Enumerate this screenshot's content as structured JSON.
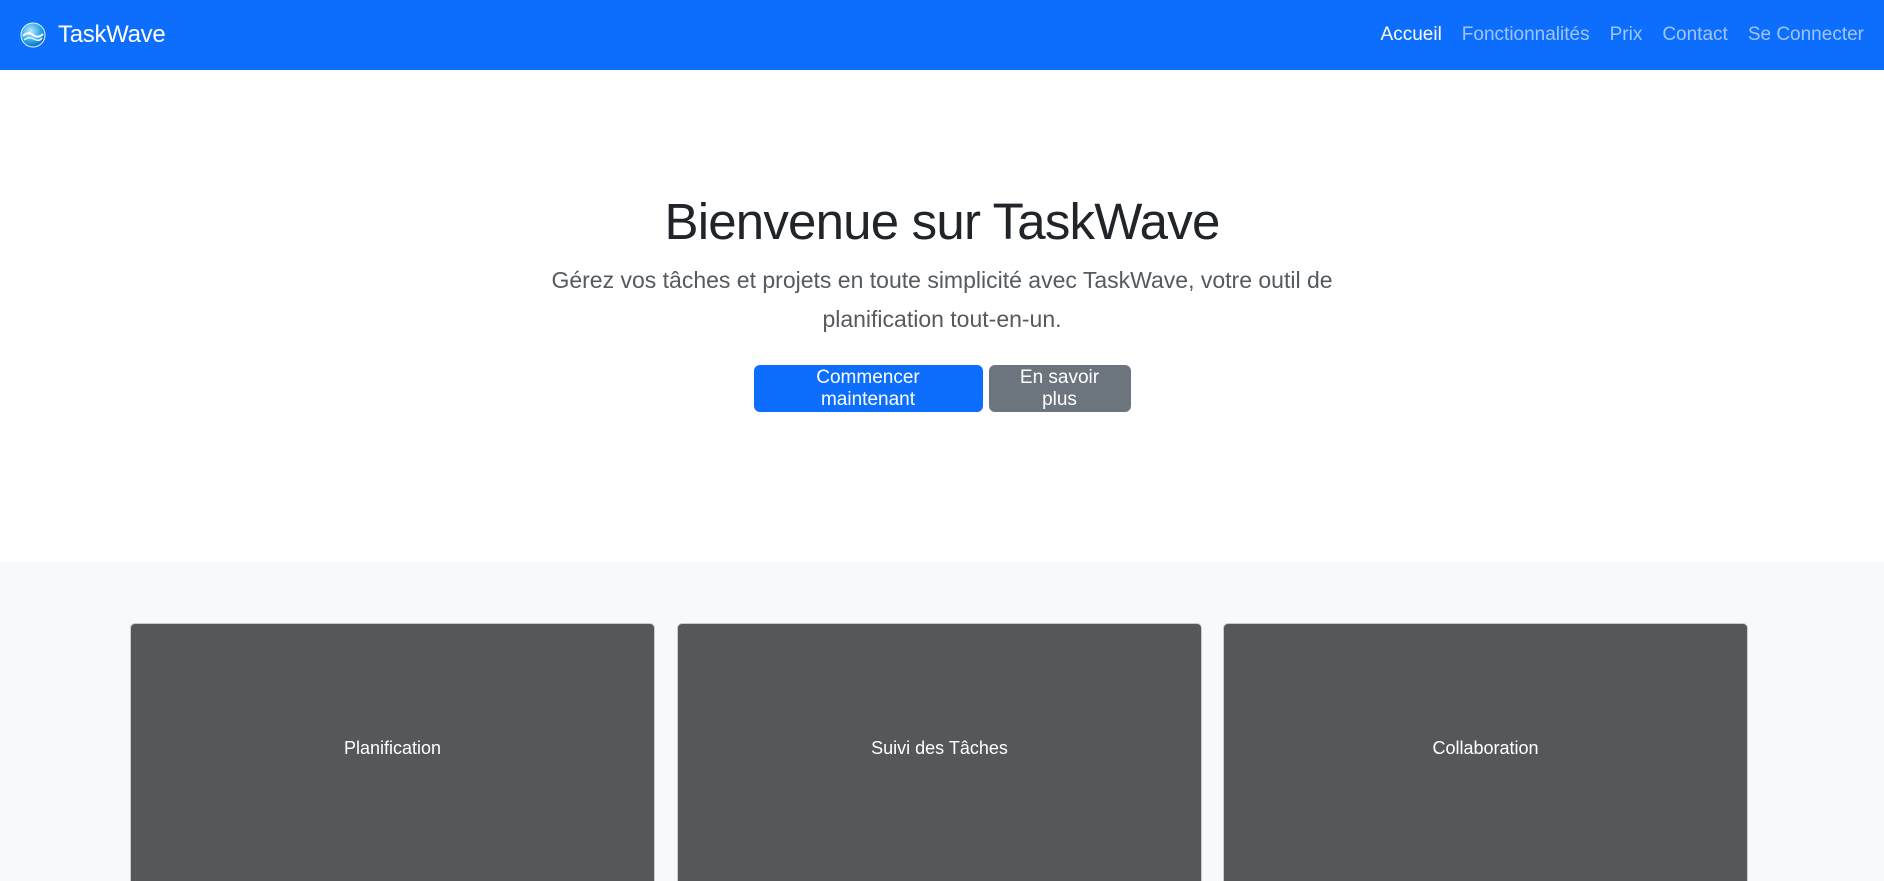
{
  "navbar": {
    "brand": "TaskWave",
    "logo_icon": "wave-globe-icon",
    "links": [
      {
        "label": "Accueil",
        "active": true
      },
      {
        "label": "Fonctionnalités",
        "active": false
      },
      {
        "label": "Prix",
        "active": false
      },
      {
        "label": "Contact",
        "active": false
      },
      {
        "label": "Se Connecter",
        "active": false
      }
    ]
  },
  "hero": {
    "title": "Bienvenue sur TaskWave",
    "subtitle": "Gérez vos tâches et projets en toute simplicité avec TaskWave, votre outil de planification tout-en-un.",
    "primary_button": "Commencer maintenant",
    "secondary_button": "En savoir plus"
  },
  "features": [
    {
      "label": "Planification"
    },
    {
      "label": "Suivi des Tâches"
    },
    {
      "label": "Collaboration"
    }
  ],
  "colors": {
    "primary": "#0d6efd",
    "secondary": "#6c757d",
    "card_bg": "#55585b",
    "section_bg": "#f8f9fa"
  }
}
